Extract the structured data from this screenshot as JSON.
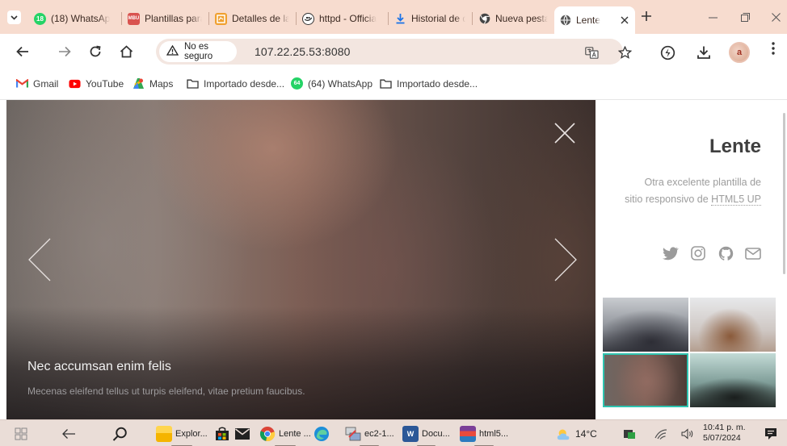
{
  "browser": {
    "tabs": [
      {
        "title": "(18) WhatsAp",
        "favicon": "whatsapp-icon",
        "badge": "18",
        "active": false
      },
      {
        "title": "Plantillas para",
        "favicon": "plantillas-icon",
        "badge": "MBU",
        "active": false
      },
      {
        "title": "Detalles de la",
        "favicon": "detalles-icon",
        "active": false
      },
      {
        "title": "httpd - Officia",
        "favicon": "docker-icon",
        "active": false
      },
      {
        "title": "Historial de d",
        "favicon": "download-icon",
        "active": false
      },
      {
        "title": "Nueva pestaña",
        "favicon": "chrome-icon",
        "active": false
      },
      {
        "title": "Lente",
        "favicon": "globe-icon",
        "active": true
      }
    ],
    "security_label": "No es seguro",
    "url": "107.22.25.53:8080",
    "bookmarks": [
      {
        "label": "Gmail",
        "icon": "gmail-icon"
      },
      {
        "label": "YouTube",
        "icon": "youtube-icon"
      },
      {
        "label": "Maps",
        "icon": "maps-icon"
      },
      {
        "label": "Importado desde...",
        "icon": "folder-icon"
      },
      {
        "label": "(64) WhatsApp",
        "icon": "whatsapp-icon",
        "badge": "64"
      },
      {
        "label": "Importado desde...",
        "icon": "folder-icon"
      }
    ],
    "avatar_letter": "a"
  },
  "page": {
    "viewer": {
      "caption_title": "Nec accumsan enim felis",
      "caption_text": "Mecenas eleifend tellus ut turpis eleifend, vitae pretium faucibus."
    },
    "sidebar": {
      "logo": "Lente",
      "tagline_before": "Otra excelente plantilla de sitio responsivo de ",
      "tagline_link": "HTML5 UP",
      "social": [
        "twitter-icon",
        "instagram-icon",
        "github-icon",
        "envelope-icon"
      ]
    }
  },
  "taskbar": {
    "items": [
      {
        "label": "Explor...",
        "icon": "file-explorer-icon"
      },
      {
        "label": "Lente ...",
        "icon": "chrome-icon"
      },
      {
        "label": "ec2-1...",
        "icon": "putty-icon"
      },
      {
        "label": "Docu...",
        "icon": "word-icon",
        "badge": "W"
      },
      {
        "label": "html5...",
        "icon": "winrar-icon"
      }
    ],
    "weather": "14°C",
    "time": "10:41 p. m.",
    "date": "5/07/2024"
  }
}
